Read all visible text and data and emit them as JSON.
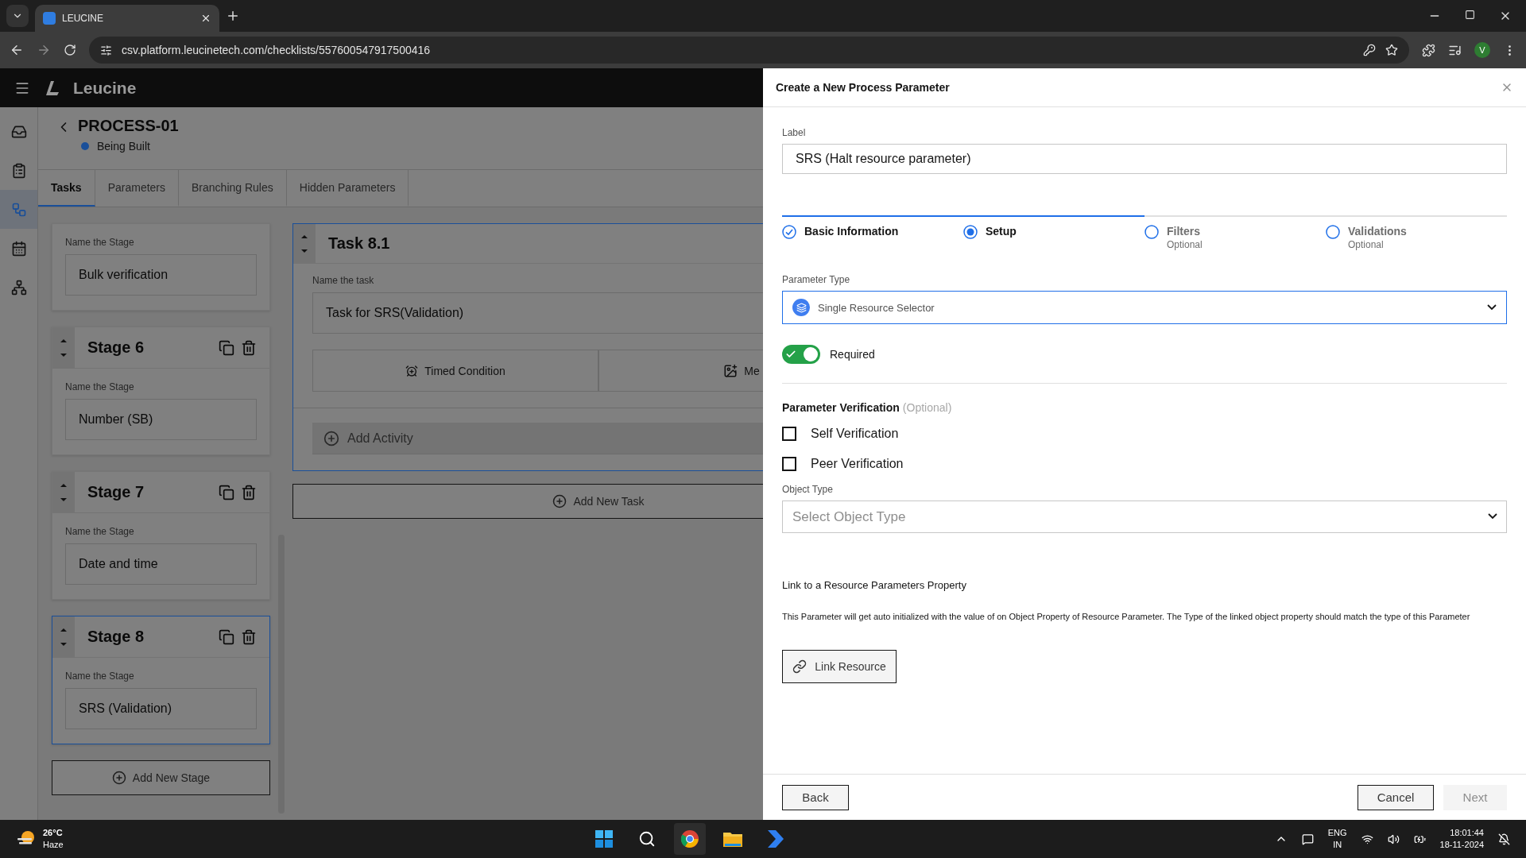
{
  "browser": {
    "tab_title": "LEUCINE",
    "url": "csv.platform.leucinetech.com/checklists/557600547917500416",
    "profile": "V"
  },
  "app": {
    "brand": "Leucine",
    "nav_items": [
      {
        "selected": false
      },
      {
        "selected": false
      },
      {
        "selected": true
      },
      {
        "selected": false
      },
      {
        "selected": false
      }
    ]
  },
  "process": {
    "title": "PROCESS-01",
    "status": "Being Built"
  },
  "tabs": [
    {
      "label": "Tasks",
      "selected": true
    },
    {
      "label": "Parameters",
      "selected": false
    },
    {
      "label": "Branching Rules",
      "selected": false
    },
    {
      "label": "Hidden Parameters",
      "selected": false
    }
  ],
  "stages": [
    {
      "label": "Name the Stage",
      "value": "Bulk verification",
      "selected": false
    },
    {
      "title": "Stage 6",
      "label": "Name the Stage",
      "value": "Number (SB)",
      "selected": false
    },
    {
      "title": "Stage 7",
      "label": "Name the Stage",
      "value": "Date and time",
      "selected": false
    },
    {
      "title": "Stage 8",
      "label": "Name the Stage",
      "value": "SRS (Validation)",
      "selected": true
    }
  ],
  "add_stage": "Add New Stage",
  "task": {
    "title": "Task 8.1",
    "label": "Name the task",
    "value": "Task for SRS(Validation)",
    "actions": [
      {
        "kind": "timed",
        "label": "Timed Condition"
      },
      {
        "kind": "media",
        "label": "Me"
      }
    ],
    "add_activity": "Add Activity"
  },
  "add_task": "Add New Task",
  "drawer": {
    "title": "Create a New Process Parameter",
    "label_caption": "Label",
    "label_value": "SRS (Halt resource parameter)",
    "steps": [
      {
        "title": "Basic Information",
        "completed": true,
        "selected": false
      },
      {
        "title": "Setup",
        "completed": false,
        "selected": true
      },
      {
        "title": "Filters",
        "subtitle": "Optional",
        "completed": false,
        "selected": false
      },
      {
        "title": "Validations",
        "subtitle": "Optional",
        "completed": false,
        "selected": false
      }
    ],
    "parameter_type": {
      "caption": "Parameter Type",
      "value": "Single Resource Selector"
    },
    "required": {
      "label": "Required",
      "on": true
    },
    "verification": {
      "title": "Parameter Verification",
      "hint": "(Optional)",
      "items": [
        {
          "label": "Self Verification",
          "checked": false
        },
        {
          "label": "Peer Verification",
          "checked": false
        }
      ]
    },
    "object_type": {
      "caption": "Object Type",
      "placeholder": "Select Object Type"
    },
    "link": {
      "title": "Link to a Resource Parameters Property",
      "description": "This Parameter will get auto initialized with the value of on Object Property of Resource Parameter. The Type of the linked object property should match the type of this Parameter",
      "button": "Link Resource"
    },
    "footer": {
      "back": "Back",
      "cancel": "Cancel",
      "next": "Next",
      "next_disabled": true
    }
  },
  "taskbar": {
    "temp": "26°C",
    "condition": "Haze",
    "lang": "ENG",
    "region": "IN",
    "time": "18:01:44",
    "date": "18-11-2024"
  }
}
